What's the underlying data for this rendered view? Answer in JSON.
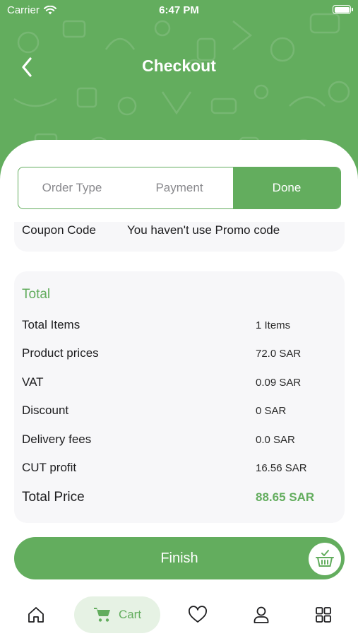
{
  "status_bar": {
    "carrier": "Carrier",
    "time": "6:47 PM"
  },
  "header": {
    "title": "Checkout"
  },
  "stepper": {
    "steps": [
      "Order Type",
      "Payment",
      "Done"
    ],
    "active_index": 2
  },
  "coupon": {
    "label": "Coupon Code",
    "value": "You haven't use Promo code"
  },
  "totals": {
    "heading": "Total",
    "rows": [
      {
        "label": "Total Items",
        "value": "1 Items"
      },
      {
        "label": "Product prices",
        "value": "72.0 SAR"
      },
      {
        "label": "VAT",
        "value": "0.09 SAR"
      },
      {
        "label": "Discount",
        "value": "0 SAR"
      },
      {
        "label": "Delivery fees",
        "value": "0.0 SAR"
      },
      {
        "label": "CUT profit",
        "value": "16.56 SAR"
      }
    ],
    "total_label": "Total Price",
    "total_value": "88.65 SAR"
  },
  "finish_button": {
    "label": "Finish"
  },
  "tab_bar": {
    "items": [
      {
        "icon": "home-icon"
      },
      {
        "icon": "cart-icon",
        "label": "Cart",
        "active": true
      },
      {
        "icon": "heart-icon"
      },
      {
        "icon": "user-icon"
      },
      {
        "icon": "grid-icon"
      }
    ]
  },
  "colors": {
    "brand": "#63ad5e",
    "card": "#f7f7f9",
    "active_tab": "#e6f2e4"
  }
}
